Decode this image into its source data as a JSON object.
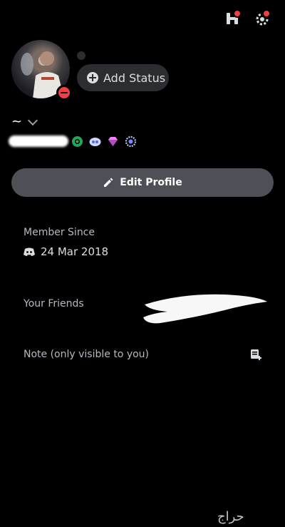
{
  "header": {
    "icons": [
      "nitro-icon",
      "settings-icon"
    ]
  },
  "profile": {
    "add_status_label": "Add Status",
    "display_name": "~",
    "username": "",
    "badges": [
      "nitro-boost-badge",
      "hypesquad-badge",
      "gem-badge",
      "laurel-badge"
    ],
    "status": "do-not-disturb"
  },
  "actions": {
    "edit_profile_label": "Edit Profile"
  },
  "sections": {
    "member_since_label": "Member Since",
    "member_since_date": "24 Mar 2018",
    "your_friends_label": "Your Friends",
    "note_label": "Note (only visible to you)"
  },
  "watermark": "حراج",
  "colors": {
    "background": "#000000",
    "button": "#4e5058",
    "status_dnd": "#f23f43",
    "muted_text": "#b5bac1"
  }
}
